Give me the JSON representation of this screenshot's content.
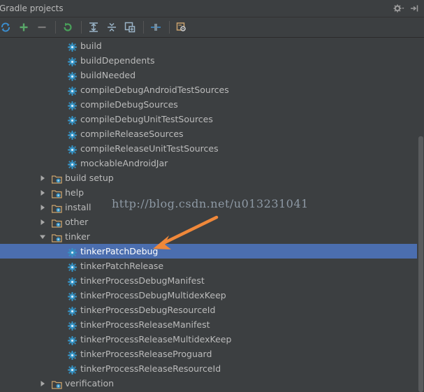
{
  "panel": {
    "title": "Gradle projects",
    "settings_icon": "gear-icon",
    "hide_icon": "hide-panel-icon"
  },
  "toolbar": {
    "buttons": [
      {
        "icon": "refresh-all-icon"
      },
      {
        "icon": "add-icon"
      },
      {
        "icon": "remove-icon"
      },
      {
        "icon": "run-task-icon"
      },
      {
        "icon": "expand-all-icon"
      },
      {
        "icon": "collapse-all-icon"
      },
      {
        "icon": "attach-project-icon"
      },
      {
        "icon": "toggle-offline-icon"
      },
      {
        "icon": "gradle-settings-icon"
      }
    ]
  },
  "tree": {
    "build_tasks": [
      "build",
      "buildDependents",
      "buildNeeded",
      "compileDebugAndroidTestSources",
      "compileDebugSources",
      "compileDebugUnitTestSources",
      "compileReleaseSources",
      "compileReleaseUnitTestSources",
      "mockableAndroidJar"
    ],
    "groups_before": [
      "build setup",
      "help",
      "install",
      "other"
    ],
    "tinker_group": "tinker",
    "tinker_tasks": [
      "tinkerPatchDebug",
      "tinkerPatchRelease",
      "tinkerProcessDebugManifest",
      "tinkerProcessDebugMultidexKeep",
      "tinkerProcessDebugResourceId",
      "tinkerProcessReleaseManifest",
      "tinkerProcessReleaseMultidexKeep",
      "tinkerProcessReleaseProguard",
      "tinkerProcessReleaseResourceId"
    ],
    "selected_task": "tinkerPatchDebug",
    "groups_after": [
      "verification"
    ]
  },
  "watermark": "http://blog.csdn.net/u013231041",
  "colors": {
    "background": "#3c3f41",
    "selection": "#4b6eaf",
    "task_gear": "#3592c4",
    "folder": "#c9a26d",
    "annotation_arrow": "#f0883a",
    "add_green": "#59a869"
  }
}
